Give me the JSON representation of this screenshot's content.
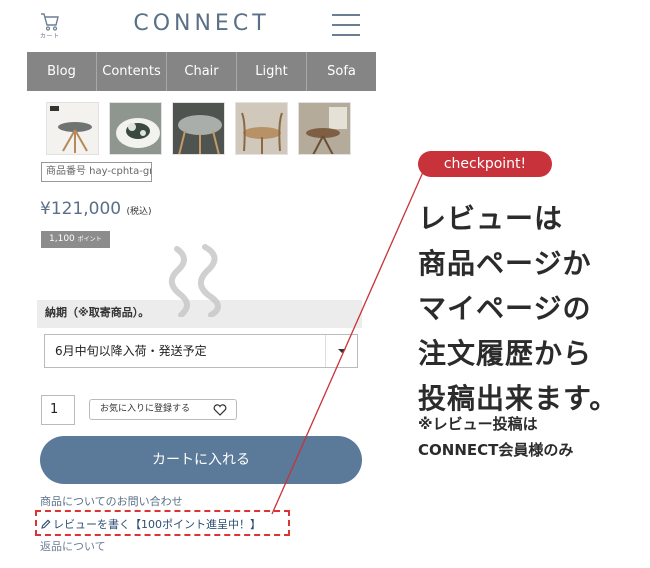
{
  "header": {
    "cart_label": "カート",
    "logo": "CONNECT",
    "accent_color": "#5a7088"
  },
  "nav": {
    "items": [
      "Blog",
      "Contents",
      "Chair",
      "Light",
      "Sofa"
    ]
  },
  "product": {
    "sku": "商品番号 hay-cphta-gr",
    "price": "¥121,000",
    "tax_note": "(税込)",
    "points_value": "1,100",
    "points_unit": "ポイント",
    "delivery_label": "納期（※取寄商品）。",
    "delivery_selected": "6月中旬以降入荷・発送予定",
    "quantity": "1",
    "favorite_label": "お気に入りに登録する",
    "cart_button": "カートに入れる"
  },
  "links": {
    "inquiry": "商品についてのお問い合わせ",
    "review": "レビューを書く【100ポイント進呈中！】",
    "returns": "返品について"
  },
  "annotation": {
    "badge": "checkpoint!",
    "badge_color": "#c8323a",
    "headline_lines": [
      "レビューは",
      "商品ページか",
      "マイページの",
      "注文履歴から",
      "投稿出来ます。"
    ],
    "note_lines": [
      "※レビュー投稿は",
      "CONNECT会員様のみ"
    ]
  }
}
